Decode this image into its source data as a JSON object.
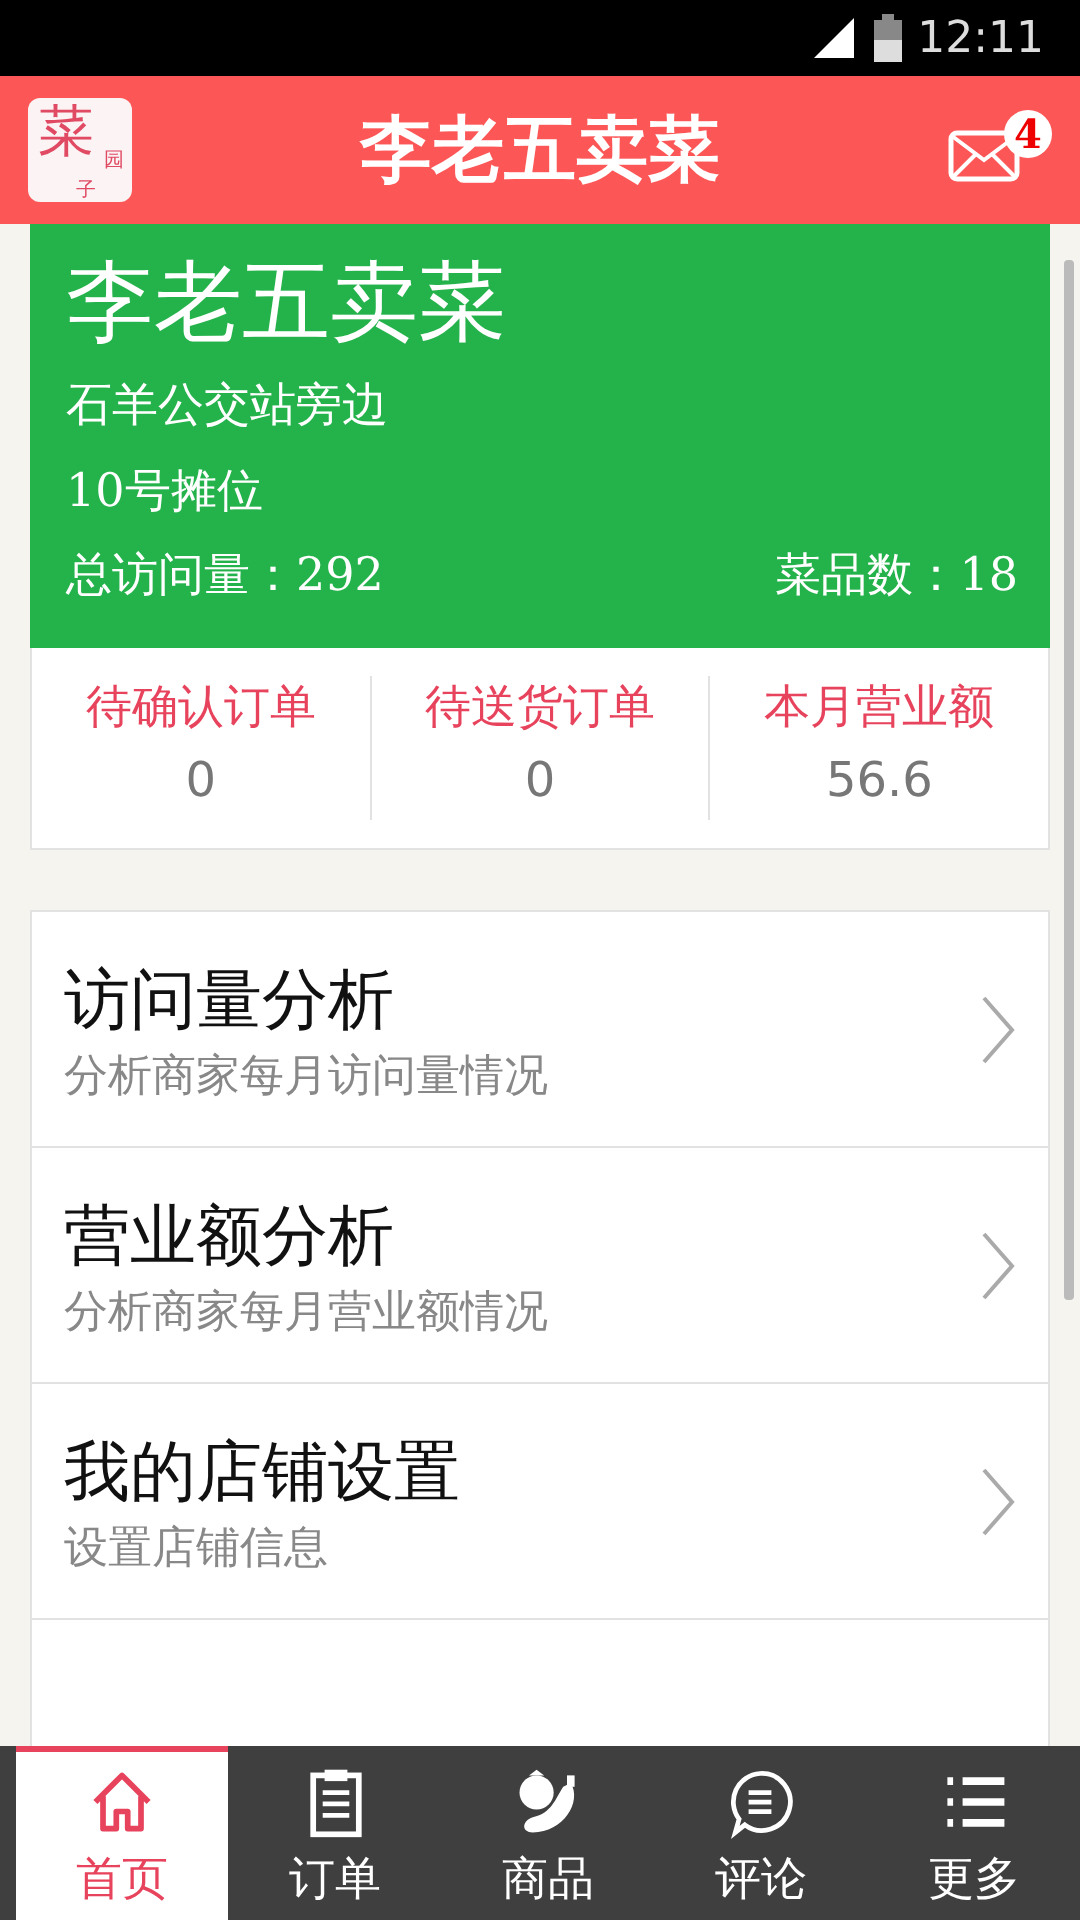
{
  "status_bar": {
    "time": "12:11"
  },
  "header": {
    "logo": {
      "main": "菜",
      "small_1": "园",
      "small_2": "子"
    },
    "title": "李老五卖菜",
    "messages_badge": "4"
  },
  "shop": {
    "name": "李老五卖菜",
    "address": "石羊公交站旁边",
    "stall": "10号摊位",
    "visits": "总访问量：292",
    "products": "菜品数：18"
  },
  "stats": [
    {
      "label": "待确认订单",
      "value": "0"
    },
    {
      "label": "待送货订单",
      "value": "0"
    },
    {
      "label": "本月营业额",
      "value": "56.6"
    }
  ],
  "menu": [
    {
      "title": "访问量分析",
      "subtitle": "分析商家每月访问量情况"
    },
    {
      "title": "营业额分析",
      "subtitle": "分析商家每月营业额情况"
    },
    {
      "title": "我的店铺设置",
      "subtitle": "设置店铺信息"
    },
    {
      "kind": "cut_off"
    }
  ],
  "tabs": [
    {
      "kind": "home",
      "label": "首页",
      "selected": true
    },
    {
      "kind": "orders",
      "label": "订单",
      "selected": false
    },
    {
      "kind": "products",
      "label": "商品",
      "selected": false
    },
    {
      "kind": "comments",
      "label": "评论",
      "selected": false
    },
    {
      "kind": "more",
      "label": "更多",
      "selected": false
    }
  ]
}
